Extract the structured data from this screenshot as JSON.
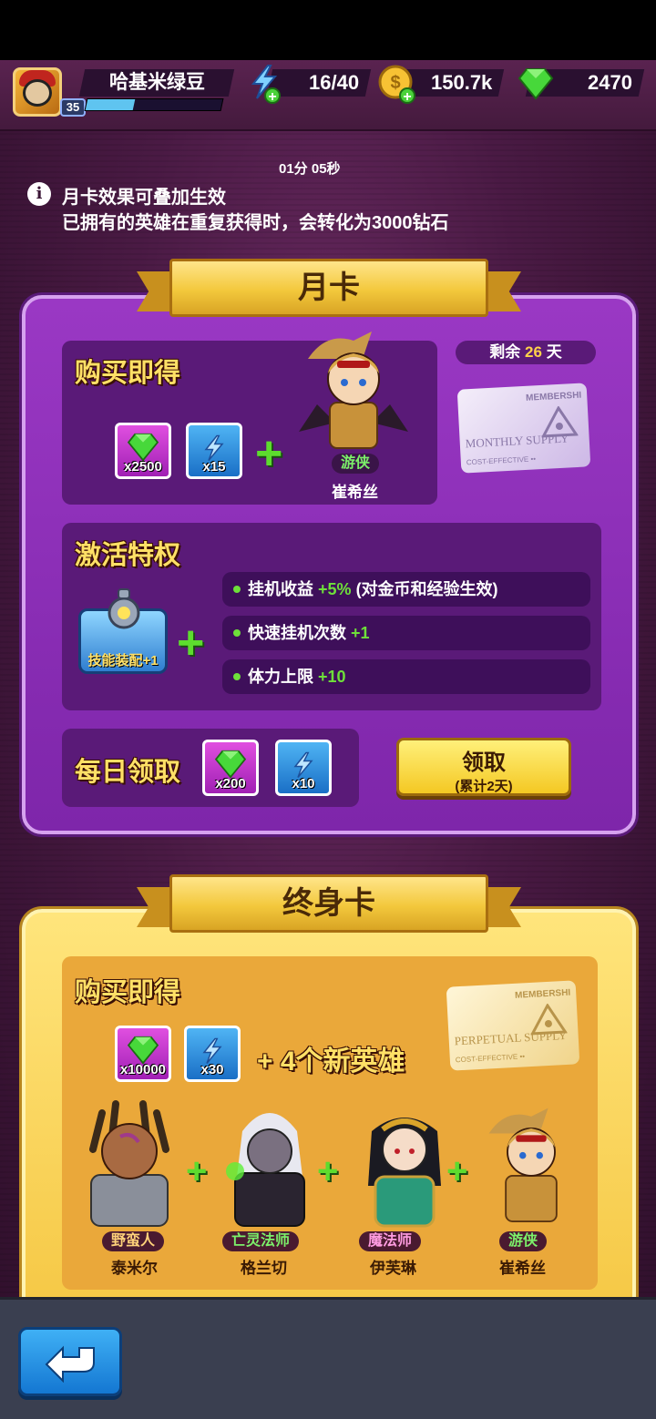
{
  "player": {
    "name": "哈基米绿豆",
    "level": "35",
    "xp_fraction": 0.35
  },
  "resources": {
    "energy": "16/40",
    "energy_timer": "01分 05秒",
    "gold": "150.7k",
    "gems": "2470"
  },
  "info": {
    "line1": "月卡效果可叠加生效",
    "line2": "已拥有的英雄在重复获得时，会转化为3000钻石"
  },
  "monthly": {
    "title": "月卡",
    "remaining_label": "剩余",
    "remaining_value": "26",
    "remaining_unit": "天",
    "buy_title": "购买即得",
    "buy_items": [
      {
        "count": "x2500",
        "type": "gem"
      },
      {
        "count": "x15",
        "type": "energy"
      }
    ],
    "hero": {
      "role": "游侠",
      "name": "崔希丝"
    },
    "card": {
      "header": "MEMBERSHI",
      "subtitle": "MONTHLY SUPPLY",
      "cost": "COST-EFFECTIVE  ••"
    },
    "privilege_title": "激活特权",
    "skill_label": "技能装配+1",
    "privileges": [
      {
        "text": "挂机收益",
        "bonus": "+5%",
        "note": "(对金币和经验生效)"
      },
      {
        "text": "快速挂机次数",
        "bonus": "+1",
        "note": ""
      },
      {
        "text": "体力上限",
        "bonus": "+10",
        "note": ""
      }
    ],
    "daily_title": "每日领取",
    "daily_items": [
      {
        "count": "x200",
        "type": "gem"
      },
      {
        "count": "x10",
        "type": "energy"
      }
    ],
    "claim_label": "领取",
    "claim_sub": "(累计2天)"
  },
  "lifetime": {
    "title": "终身卡",
    "buy_title": "购买即得",
    "buy_items": [
      {
        "count": "x10000",
        "type": "gem"
      },
      {
        "count": "x30",
        "type": "energy"
      }
    ],
    "extra": "+ 4个新英雄",
    "card": {
      "header": "MEMBERSHI",
      "subtitle": "PERPETUAL SUPPLY",
      "cost": "COST-EFFECTIVE  ••"
    },
    "heroes": [
      {
        "role": "野蛮人",
        "name": "泰米尔",
        "role_color": "#ffd27a"
      },
      {
        "role": "亡灵法师",
        "name": "格兰切",
        "role_color": "#7cf06a"
      },
      {
        "role": "魔法师",
        "name": "伊芙琳",
        "role_color": "#ff9ce0"
      },
      {
        "role": "游侠",
        "name": "崔希丝",
        "role_color": "#7cf06a"
      }
    ]
  },
  "colors": {
    "green": "#6ee03a",
    "gold": "#ffe066",
    "purple": "#8a2fb8"
  }
}
